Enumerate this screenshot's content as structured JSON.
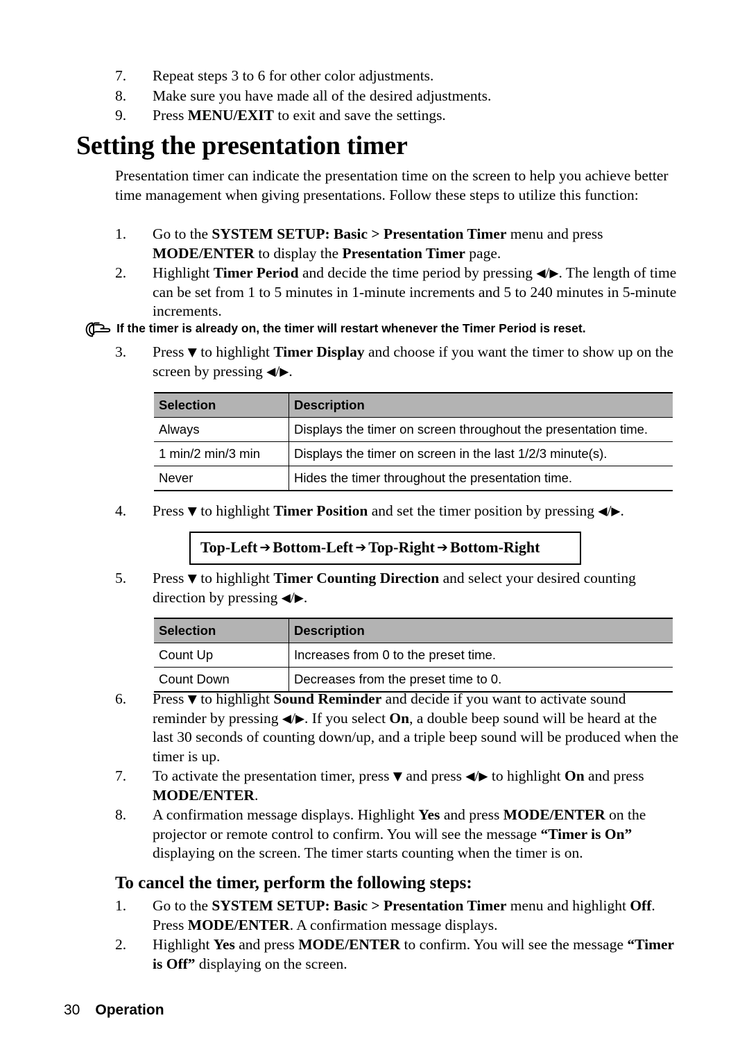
{
  "page": {
    "footer_page_number": "30",
    "footer_section": "Operation"
  },
  "top_steps": {
    "items": [
      {
        "num": "7.",
        "text_pre": "Repeat steps 3 to 6 for other color adjustments."
      },
      {
        "num": "8.",
        "text_pre": "Make sure you have made all of the desired adjustments."
      },
      {
        "num": "9.",
        "text_pre": "Press ",
        "bold1": "MENU/EXIT",
        "text_post": " to exit and save the settings."
      }
    ]
  },
  "heading": {
    "title": "Setting the presentation timer",
    "subheading": "To cancel the timer, perform the following steps:"
  },
  "intro": {
    "paragraph": "Presentation timer can indicate the presentation time on the screen to help you achieve better time management when giving presentations. Follow these steps to utilize this function:"
  },
  "steps": {
    "s1_num": "1.",
    "s1_a": "Go to the ",
    "s1_b1": "SYSTEM SETUP: Basic > Presentation Timer",
    "s1_c": " menu and press ",
    "s1_b2": "MODE/ENTER",
    "s1_d": " to display the ",
    "s1_b3": "Presentation Timer",
    "s1_e": " page.",
    "s2_num": "2.",
    "s2_a": "Highlight ",
    "s2_b1": "Timer Period",
    "s2_c": " and decide the time period by pressing ",
    "s2_d": ". The length of time can be set from 1 to 5 minutes in 1-minute increments and 5 to 240 minutes in 5-minute increments.",
    "s3_num": "3.",
    "s3_a": "Press ",
    "s3_b1": "Timer Display",
    "s3_c": " to highlight ",
    "s3_d": " and choose if you want the timer to show up on the screen by pressing ",
    "s3_e": ".",
    "s4_num": "4.",
    "s4_a": "Press ",
    "s4_c": " to highlight ",
    "s4_b1": "Timer Position",
    "s4_d": " and set the timer position by pressing ",
    "s4_e": ".",
    "s5_num": "5.",
    "s5_a": "Press ",
    "s5_c": " to highlight ",
    "s5_b1": "Timer Counting Direction",
    "s5_d": " and select your desired counting direction by pressing ",
    "s5_e": ".",
    "s6_num": "6.",
    "s6_a": "Press ",
    "s6_c": " to highlight ",
    "s6_b1": "Sound Reminder",
    "s6_d": " and decide if you want to activate sound reminder by pressing ",
    "s6_e": ". If you select ",
    "s6_b2": "On",
    "s6_f": ", a double beep sound will be heard at the last 30 seconds of counting down/up, and a triple beep sound will be produced when the timer is up.",
    "s7_num": "7.",
    "s7_a": "To activate the presentation timer, press ",
    "s7_c": " and press ",
    "s7_d": " to highlight ",
    "s7_b1": "On",
    "s7_e": " and press ",
    "s7_b2": "MODE/ENTER",
    "s7_f": ".",
    "s8_num": "8.",
    "s8_a": "A confirmation message displays. Highlight ",
    "s8_b1": "Yes",
    "s8_c": " and press ",
    "s8_b2": "MODE/ENTER",
    "s8_d": " on the projector or remote control to confirm. You will see the message ",
    "s8_b3": "“Timer is On”",
    "s8_e": " displaying on the screen. The timer starts counting when the timer is on."
  },
  "cancel_steps": {
    "c1_num": "1.",
    "c1_a": "Go to the ",
    "c1_b1": "SYSTEM SETUP: Basic > Presentation Timer",
    "c1_c": " menu and highlight ",
    "c1_b2": "Off",
    "c1_d": ". Press ",
    "c1_b3": "MODE/ENTER",
    "c1_e": ". A confirmation message displays.",
    "c2_num": "2.",
    "c2_a": "Highlight ",
    "c2_b1": "Yes",
    "c2_c": " and press ",
    "c2_b2": "MODE/ENTER",
    "c2_d": " to confirm. You will see the message ",
    "c2_b3": "“Timer is Off”",
    "c2_e": " displaying on the screen."
  },
  "note": {
    "icon": "pointing-hand-icon",
    "text": "If the timer is already on, the timer will restart whenever the Timer Period is reset."
  },
  "timer_display_table": {
    "headers": [
      "Selection",
      "Description"
    ],
    "rows": [
      [
        "Always",
        "Displays the timer on screen throughout the presentation time."
      ],
      [
        "1 min/2 min/3 min",
        "Displays the timer on screen in the last 1/2/3 minute(s)."
      ],
      [
        "Never",
        "Hides the timer throughout the presentation time."
      ]
    ]
  },
  "counting_direction_table": {
    "headers": [
      "Selection",
      "Description"
    ],
    "rows": [
      [
        "Count Up",
        "Increases from 0 to the preset time."
      ],
      [
        "Count Down",
        "Decreases from the preset time to 0."
      ]
    ]
  },
  "position_sequence": {
    "items": [
      "Top-Left",
      "Bottom-Left",
      "Top-Right",
      "Bottom-Right"
    ],
    "arrow": "➔"
  },
  "glyphs": {
    "left_triangle": "◀",
    "right_triangle": "▶",
    "down_triangle": "▼",
    "slash": "/"
  },
  "colors": {
    "table_header_bg": "#b3b3b3",
    "text": "#000000",
    "page_bg": "#ffffff"
  }
}
